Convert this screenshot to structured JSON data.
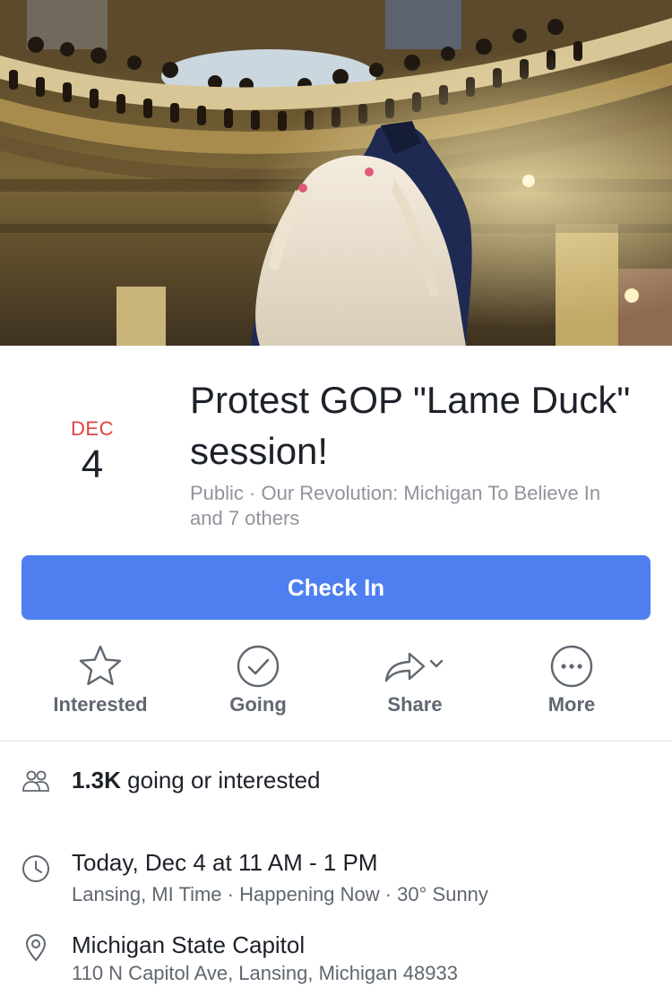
{
  "event": {
    "date_month": "DEC",
    "date_day": "4",
    "title": "Protest GOP \"Lame Duck\" session!",
    "subtitle": "Public · Our Revolution: Michigan To Believe In and 7 others"
  },
  "check_in": {
    "label": "Check In"
  },
  "actions": [
    {
      "label": "Interested",
      "icon": "star-icon"
    },
    {
      "label": "Going",
      "icon": "checkmark-circle-icon"
    },
    {
      "label": "Share",
      "icon": "share-arrow-icon"
    },
    {
      "label": "More",
      "icon": "more-dots-icon"
    }
  ],
  "info": {
    "attendance_count": "1.3K",
    "attendance_text": " going or interested",
    "time_main": "Today, Dec 4 at 11 AM - 1 PM",
    "time_sub": "Lansing, MI Time · Happening Now · 30° Sunny",
    "location_name": "Michigan State Capitol",
    "location_address": "110 N Capitol Ave, Lansing, Michigan 48933"
  },
  "colors": {
    "accent": "#4e7ff1",
    "date_month": "#e04040",
    "secondary_text": "#90949c"
  }
}
